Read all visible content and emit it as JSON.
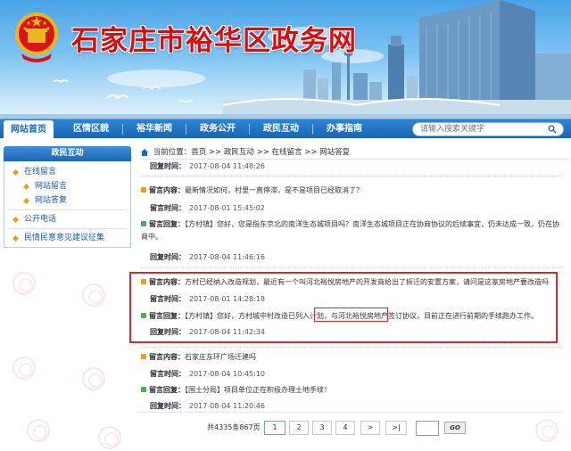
{
  "banner": {
    "site_title": "石家庄市裕华区政务网"
  },
  "nav": {
    "items": [
      "网站首页",
      "区情区貌",
      "裕华新闻",
      "政务公开",
      "政民互动",
      "办事指南"
    ],
    "active_index": 0,
    "search_placeholder": "请输入搜索关键字"
  },
  "sidebar": {
    "heading": "政民互动",
    "items": [
      {
        "label": "在线留言",
        "level": 1
      },
      {
        "label": "网站留言",
        "level": 2
      },
      {
        "label": "网站答复",
        "level": 2
      },
      {
        "label": "公开电话",
        "level": 1
      },
      {
        "label": "民情民意意见建议征集",
        "level": 1
      }
    ]
  },
  "breadcrumb": {
    "prefix": "当前位置：",
    "path": "首页 >> 政民互动 >> 在线留言 >> 网站答复"
  },
  "labels": {
    "message": "留言内容：",
    "reply": "留言回复：",
    "reply_time": "回复时间：",
    "message_time": "留言时间："
  },
  "messages": {
    "top_reply_time": "2017-08-04 11:48:26",
    "m1": {
      "content": "最新情况如何，村里一直停滞，是不是项目已经取消了？",
      "message_time": "2017-08-01 15:45:02",
      "reply": "【方村镇】您好，您是指东京北的南洋生态城项目吗？南洋生态城项目正在协商协议的后续事宜，仍未达成一致，仍在协商中。",
      "reply_time": "2017-08-04 11:46:16"
    },
    "m2": {
      "content": "方村已经纳入改造规划，最近有一个叫河北裕悦房地产的开发商给出了拆迁的安置方案，请问是这家房地产要改造吗",
      "message_time": "2017-08-01 14:28:18",
      "reply": "【方村镇】您好，方村城中村改造已列入计划，与河北裕悦房地产签订协议，目前正在进行前期的手续跑办工作。",
      "reply_time": "2017-08-04 11:42:34"
    },
    "m3": {
      "content": "石家庄东环广场迁建吗",
      "message_time": "2017-08-04 10:45:10",
      "reply": "【国土分局】项目单位正在积极办理土地手续！",
      "reply_time": "2017-08-04 11:20:46"
    }
  },
  "pager": {
    "total": "共4335条867页",
    "pages": [
      "1",
      "2",
      "3",
      "4"
    ],
    "next": ">",
    "last": ">|",
    "go": "GO",
    "current": "1"
  },
  "colors": {
    "title_red": "#d40f10",
    "nav_blue": "#1a64b3",
    "highlight_red": "#d92b2b",
    "link_blue": "#1d57a3"
  }
}
